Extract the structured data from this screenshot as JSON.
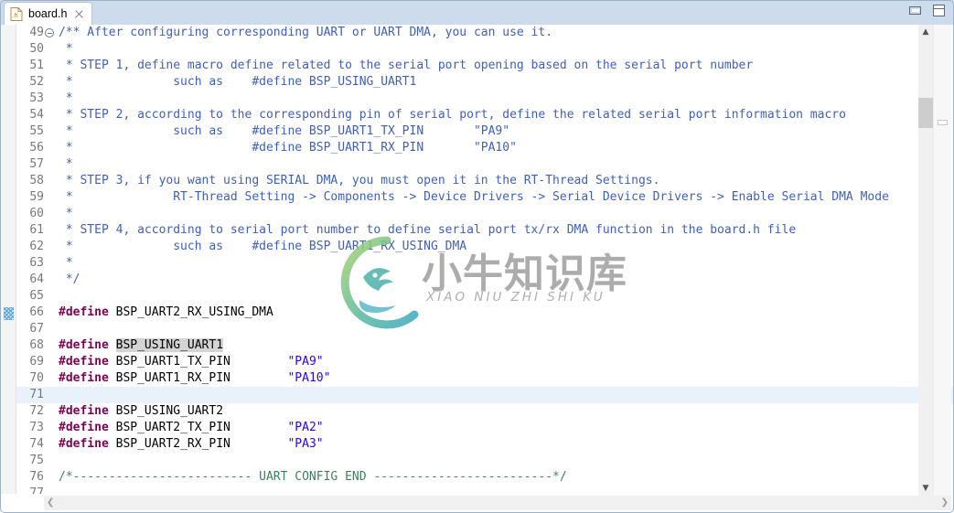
{
  "window": {
    "minimize_label": "Minimize",
    "maximize_label": "Maximize",
    "min_icon": "minimize-icon",
    "max_icon": "maximize-icon"
  },
  "tab": {
    "label": "board.h",
    "icon": "h-file-icon",
    "close_icon": "close-icon",
    "close_label": "Close"
  },
  "editor": {
    "first_line": 49,
    "fold_marker_line": 49,
    "current_line": 71,
    "diff_marker_line": 66,
    "occurrence_highlight": "BSP_USING_UART1",
    "lines": [
      {
        "no": 49,
        "fold": true,
        "segments": [
          {
            "cls": "c-comment",
            "text": "/** After configuring corresponding UART or UART DMA, you can use it."
          }
        ]
      },
      {
        "no": 50,
        "fold": false,
        "segments": [
          {
            "cls": "c-comment",
            "text": " *"
          }
        ]
      },
      {
        "no": 51,
        "fold": false,
        "segments": [
          {
            "cls": "c-comment",
            "text": " * STEP 1, define macro define related to the serial port opening based on the serial port number"
          }
        ]
      },
      {
        "no": 52,
        "fold": false,
        "segments": [
          {
            "cls": "c-comment",
            "text": " *              such as    #define BSP_USING_UART1"
          }
        ]
      },
      {
        "no": 53,
        "fold": false,
        "segments": [
          {
            "cls": "c-comment",
            "text": " *"
          }
        ]
      },
      {
        "no": 54,
        "fold": false,
        "segments": [
          {
            "cls": "c-comment",
            "text": " * STEP 2, according to the corresponding pin of serial port, define the related serial port information macro"
          }
        ]
      },
      {
        "no": 55,
        "fold": false,
        "segments": [
          {
            "cls": "c-comment",
            "text": " *              such as    #define BSP_UART1_TX_PIN       \"PA9\""
          }
        ]
      },
      {
        "no": 56,
        "fold": false,
        "segments": [
          {
            "cls": "c-comment",
            "text": " *                         #define BSP_UART1_RX_PIN       \"PA10\""
          }
        ]
      },
      {
        "no": 57,
        "fold": false,
        "segments": [
          {
            "cls": "c-comment",
            "text": " *"
          }
        ]
      },
      {
        "no": 58,
        "fold": false,
        "segments": [
          {
            "cls": "c-comment",
            "text": " * STEP 3, if you want using SERIAL DMA, you must open it in the RT-Thread Settings."
          }
        ]
      },
      {
        "no": 59,
        "fold": false,
        "segments": [
          {
            "cls": "c-comment",
            "text": " *              RT-Thread Setting -> Components -> Device Drivers -> Serial Device Drivers -> Enable Serial DMA Mode"
          }
        ]
      },
      {
        "no": 60,
        "fold": false,
        "segments": [
          {
            "cls": "c-comment",
            "text": " *"
          }
        ]
      },
      {
        "no": 61,
        "fold": false,
        "segments": [
          {
            "cls": "c-comment",
            "text": " * STEP 4, according to serial port number to define serial port tx/rx DMA function in the board.h file"
          }
        ]
      },
      {
        "no": 62,
        "fold": false,
        "segments": [
          {
            "cls": "c-comment",
            "text": " *              such as    #define BSP_UART1_RX_USING_DMA"
          }
        ]
      },
      {
        "no": 63,
        "fold": false,
        "segments": [
          {
            "cls": "c-comment",
            "text": " *"
          }
        ]
      },
      {
        "no": 64,
        "fold": false,
        "segments": [
          {
            "cls": "c-comment",
            "text": " */"
          }
        ]
      },
      {
        "no": 65,
        "fold": false,
        "segments": [
          {
            "cls": "c-plain",
            "text": ""
          }
        ]
      },
      {
        "no": 66,
        "fold": false,
        "segments": [
          {
            "cls": "c-pre",
            "text": "#define"
          },
          {
            "cls": "c-plain",
            "text": " BSP_UART2_RX_USING_DMA"
          }
        ]
      },
      {
        "no": 67,
        "fold": false,
        "segments": [
          {
            "cls": "c-plain",
            "text": ""
          }
        ]
      },
      {
        "no": 68,
        "fold": false,
        "segments": [
          {
            "cls": "c-pre",
            "text": "#define"
          },
          {
            "cls": "c-plain",
            "text": " "
          },
          {
            "cls": "c-plain occ",
            "text": "BSP_USING_UART1"
          }
        ]
      },
      {
        "no": 69,
        "fold": false,
        "segments": [
          {
            "cls": "c-pre",
            "text": "#define"
          },
          {
            "cls": "c-plain",
            "text": " BSP_UART1_TX_PIN        "
          },
          {
            "cls": "c-string",
            "text": "\"PA9\""
          }
        ]
      },
      {
        "no": 70,
        "fold": false,
        "segments": [
          {
            "cls": "c-pre",
            "text": "#define"
          },
          {
            "cls": "c-plain",
            "text": " BSP_UART1_RX_PIN        "
          },
          {
            "cls": "c-string",
            "text": "\"PA10\""
          }
        ]
      },
      {
        "no": 71,
        "fold": false,
        "segments": [
          {
            "cls": "c-plain",
            "text": ""
          }
        ]
      },
      {
        "no": 72,
        "fold": false,
        "segments": [
          {
            "cls": "c-pre",
            "text": "#define"
          },
          {
            "cls": "c-plain",
            "text": " BSP_USING_UART2"
          }
        ]
      },
      {
        "no": 73,
        "fold": false,
        "segments": [
          {
            "cls": "c-pre",
            "text": "#define"
          },
          {
            "cls": "c-plain",
            "text": " BSP_UART2_TX_PIN        "
          },
          {
            "cls": "c-string",
            "text": "\"PA2\""
          }
        ]
      },
      {
        "no": 74,
        "fold": false,
        "segments": [
          {
            "cls": "c-pre",
            "text": "#define"
          },
          {
            "cls": "c-plain",
            "text": " BSP_UART2_RX_PIN        "
          },
          {
            "cls": "c-string",
            "text": "\"PA3\""
          }
        ]
      },
      {
        "no": 75,
        "fold": false,
        "segments": [
          {
            "cls": "c-plain",
            "text": ""
          }
        ]
      },
      {
        "no": 76,
        "fold": false,
        "segments": [
          {
            "cls": "c-comment2",
            "text": "/*------------------------- UART CONFIG END -------------------------*/"
          }
        ]
      },
      {
        "no": 77,
        "fold": false,
        "segments": [
          {
            "cls": "c-plain",
            "text": ""
          }
        ]
      }
    ]
  },
  "watermark": {
    "text_cn": "小牛知识库",
    "text_en": "XIAO NIU ZHI SHI KU",
    "logo_icon": "circular-leaf-logo-icon",
    "color_green": "#8cc63f",
    "color_teal": "#3aa8c1"
  },
  "scrollbars": {
    "vertical_up_icon": "chevron-up-icon",
    "vertical_down_icon": "chevron-down-icon",
    "horizontal_left_icon": "chevron-left-icon",
    "horizontal_right_icon": "chevron-right-icon",
    "overview_marker": "overview-ruler-marker"
  },
  "colors": {
    "titlebar": "#cddcec",
    "comment_blue": "#3f5fbf",
    "comment_green": "#3f7f5f",
    "preprocessor": "#7f0055",
    "string": "#2a00ff",
    "current_line": "#e9f2fb",
    "occurrence": "#d4d4d4"
  }
}
